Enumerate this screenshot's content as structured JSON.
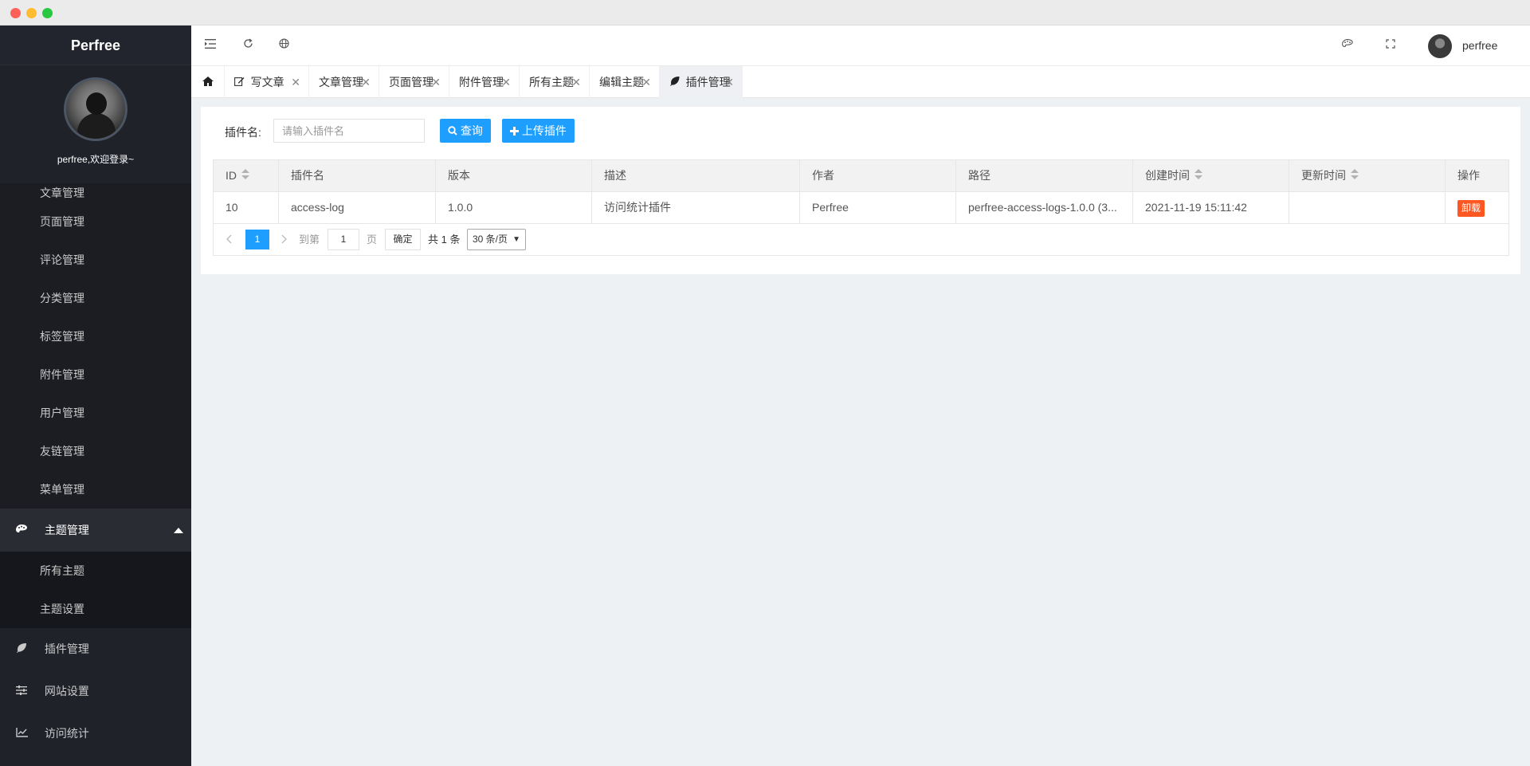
{
  "app": {
    "brand": "Perfree",
    "welcome": "perfree,欢迎登录~"
  },
  "sidebar": {
    "items": [
      "文章管理",
      "页面管理",
      "评论管理",
      "分类管理",
      "标签管理",
      "附件管理",
      "用户管理",
      "友链管理",
      "菜单管理"
    ],
    "theme_group": {
      "label": "主题管理",
      "icon": "palette-icon",
      "children": [
        "所有主题",
        "主题设置"
      ]
    },
    "bottom": [
      {
        "label": "插件管理",
        "icon": "leaf-icon"
      },
      {
        "label": "网站设置",
        "icon": "sliders-icon"
      },
      {
        "label": "访问统计",
        "icon": "chart-line-icon"
      }
    ]
  },
  "topbar": {
    "username": "perfree"
  },
  "tabs": [
    {
      "label": "",
      "icon": "home-icon"
    },
    {
      "label": "写文章",
      "icon": "edit-icon"
    },
    {
      "label": "文章管理"
    },
    {
      "label": "页面管理"
    },
    {
      "label": "附件管理"
    },
    {
      "label": "所有主题"
    },
    {
      "label": "编辑主题"
    },
    {
      "label": "插件管理",
      "icon": "leaf-icon",
      "active": true
    }
  ],
  "search": {
    "label": "插件名:",
    "placeholder": "请输入插件名",
    "query_label": "查询",
    "upload_label": "上传插件"
  },
  "table": {
    "headers": [
      "ID",
      "插件名",
      "版本",
      "描述",
      "作者",
      "路径",
      "创建时间",
      "更新时间",
      "操作"
    ],
    "rows": [
      {
        "id": "10",
        "name": "access-log",
        "version": "1.0.0",
        "desc": "访问统计插件",
        "author": "Perfree",
        "path": "perfree-access-logs-1.0.0 (3...",
        "created": "2021-11-19 15:11:42",
        "updated": "",
        "action": "卸载"
      }
    ]
  },
  "pager": {
    "current": "1",
    "goto_label": "到第",
    "page_value": "1",
    "page_unit": "页",
    "confirm": "确定",
    "total": "共 1 条",
    "page_size": "30 条/页"
  },
  "colors": {
    "primary": "#1e9fff",
    "danger": "#ff5722",
    "sidebar_bg": "#20222a"
  }
}
